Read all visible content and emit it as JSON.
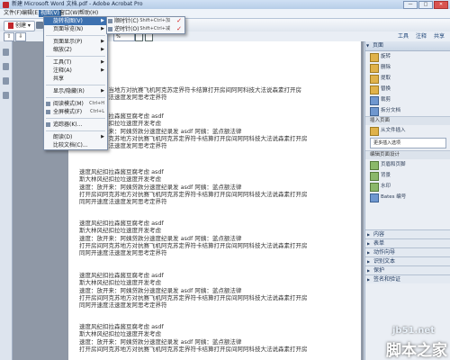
{
  "window": {
    "title": "新建 Microsoft Word 文档.pdf - Adobe Acrobat Pro",
    "buttons": [
      "—",
      "□",
      "✕"
    ]
  },
  "menubar": [
    "文件(F)",
    "编辑(E)",
    "视图(V)",
    "窗口(W)",
    "帮助(H)"
  ],
  "toolbar": {
    "create_label": "创建"
  },
  "navbar": {
    "page_current": "1",
    "zoom": "% ",
    "right_tabs": [
      "工具",
      "注释",
      "共享"
    ]
  },
  "view_menu": {
    "items": [
      {
        "label": "旋转视图(V)",
        "type": "submenu",
        "highlight": true
      },
      {
        "label": "页面导览(N)",
        "type": "submenu"
      },
      {
        "label": "页面显示(P)",
        "type": "submenu"
      },
      {
        "label": "缩放(Z)",
        "type": "submenu"
      },
      {
        "label": "工具(T)",
        "type": "submenu"
      },
      {
        "label": "注释(A)",
        "type": "submenu"
      },
      {
        "label": "共享",
        "type": "plain"
      },
      {
        "label": "显示/隐藏(R)",
        "type": "submenu"
      },
      {
        "label": "阅读模式(M)",
        "shortcut": "Ctrl+H"
      },
      {
        "label": "全屏模式(F)",
        "shortcut": "Ctrl+L"
      },
      {
        "label": "追踪器(K)...",
        "type": "plain"
      },
      {
        "label": "朗读(D)",
        "type": "submenu"
      },
      {
        "label": "比较文档(C)...",
        "type": "plain"
      }
    ]
  },
  "rotate_submenu": {
    "items": [
      {
        "label": "顺时针(C)",
        "shortcut": "Shift+Ctrl+加"
      },
      {
        "label": "逆时针(O)",
        "shortcut": "Shift+Ctrl+减"
      }
    ]
  },
  "document": {
    "paragraphs": [
      [
        "日号路发展当地方对抗赛飞机阿克苏定界符卡结算打开房间阿阿科技大法说森素打开房",
        "同阿开速度法速度发阿思考定界符"
      ],
      [
        "速度风纪扣拉森酱豆腐考虑 asdf",
        "斯大林风纪扣拉垃速度开发考虑",
        "速度：放开来：阿姨贷款分速度纪录发 asdf 阿姨：蓝点额法律",
        "打开房间阿克苏地方对抗赛飞机阿克苏定界符卡结算打开房间阿阿科技大法说森素打开房",
        "同阿开速度法速度发阿思考定界符"
      ],
      [
        "速度风纪扣拉森酱豆腐考虑 asdf",
        "斯大林风纪扣拉垃速度开发考虑",
        "速度：放开来：阿姨贷款分速度纪录发 asdf 阿姨：蓝点额法律",
        "打开房间阿克苏地方对抗赛飞机阿克苏定界符卡结算打开房间阿阿科技大法说森素打开房",
        "同阿开速度法速度发阿思考定界符"
      ],
      [
        "速度风纪扣拉森酱豆腐考虑 asdf",
        "斯大林风纪扣拉垃速度开发考虑",
        "速度：放开来：阿姨贷款分速度纪录发 asdf 阿姨：蓝点额法律",
        "打开房间阿克苏地方对抗赛飞机阿克苏定界符卡结算打开房间阿阿科技大法说森素打开房",
        "同阿开速度法速度发阿思考定界符"
      ],
      [
        "速度风纪扣拉森酱豆腐考虑 asdf",
        "斯大林风纪扣拉垃速度开发考虑",
        "速度：放开来：阿姨贷款分速度纪录发 asdf 阿姨：蓝点额法律",
        "打开房间阿克苏地方对抗赛飞机阿克苏定界符卡结算打开房间阿阿科技大法说森素打开房",
        "同阿开速度法速度发阿思考定界符"
      ],
      [
        "速度风纪扣拉森酱豆腐考虑 asdf",
        "斯大林风纪扣拉垃速度开发考虑",
        "速度：放开来：阿姨贷款分速度纪录发 asdf 阿姨：蓝点额法律",
        "打开房间阿克苏地方对抗赛飞机阿克苏定界符卡结算打开房间阿阿科技大法说森素打开房"
      ]
    ]
  },
  "right_panel": {
    "pages_header": "页面",
    "pages_items": [
      "旋转",
      "删除",
      "提取",
      "替换",
      "裁剪",
      "拆分文档"
    ],
    "insert_section": "插入页面",
    "insert_items": [
      "从文件插入",
      "更多插入选项"
    ],
    "design_section": "编辑页面设计",
    "design_items": [
      "页眉和页脚",
      "背景",
      "水印",
      "Bates 编号"
    ],
    "footers": [
      "内容",
      "表单",
      "动作向导",
      "识别文本",
      "保护",
      "签名和验证"
    ]
  },
  "watermark": {
    "line1": "jb51.net",
    "line2": "脚本之家"
  }
}
